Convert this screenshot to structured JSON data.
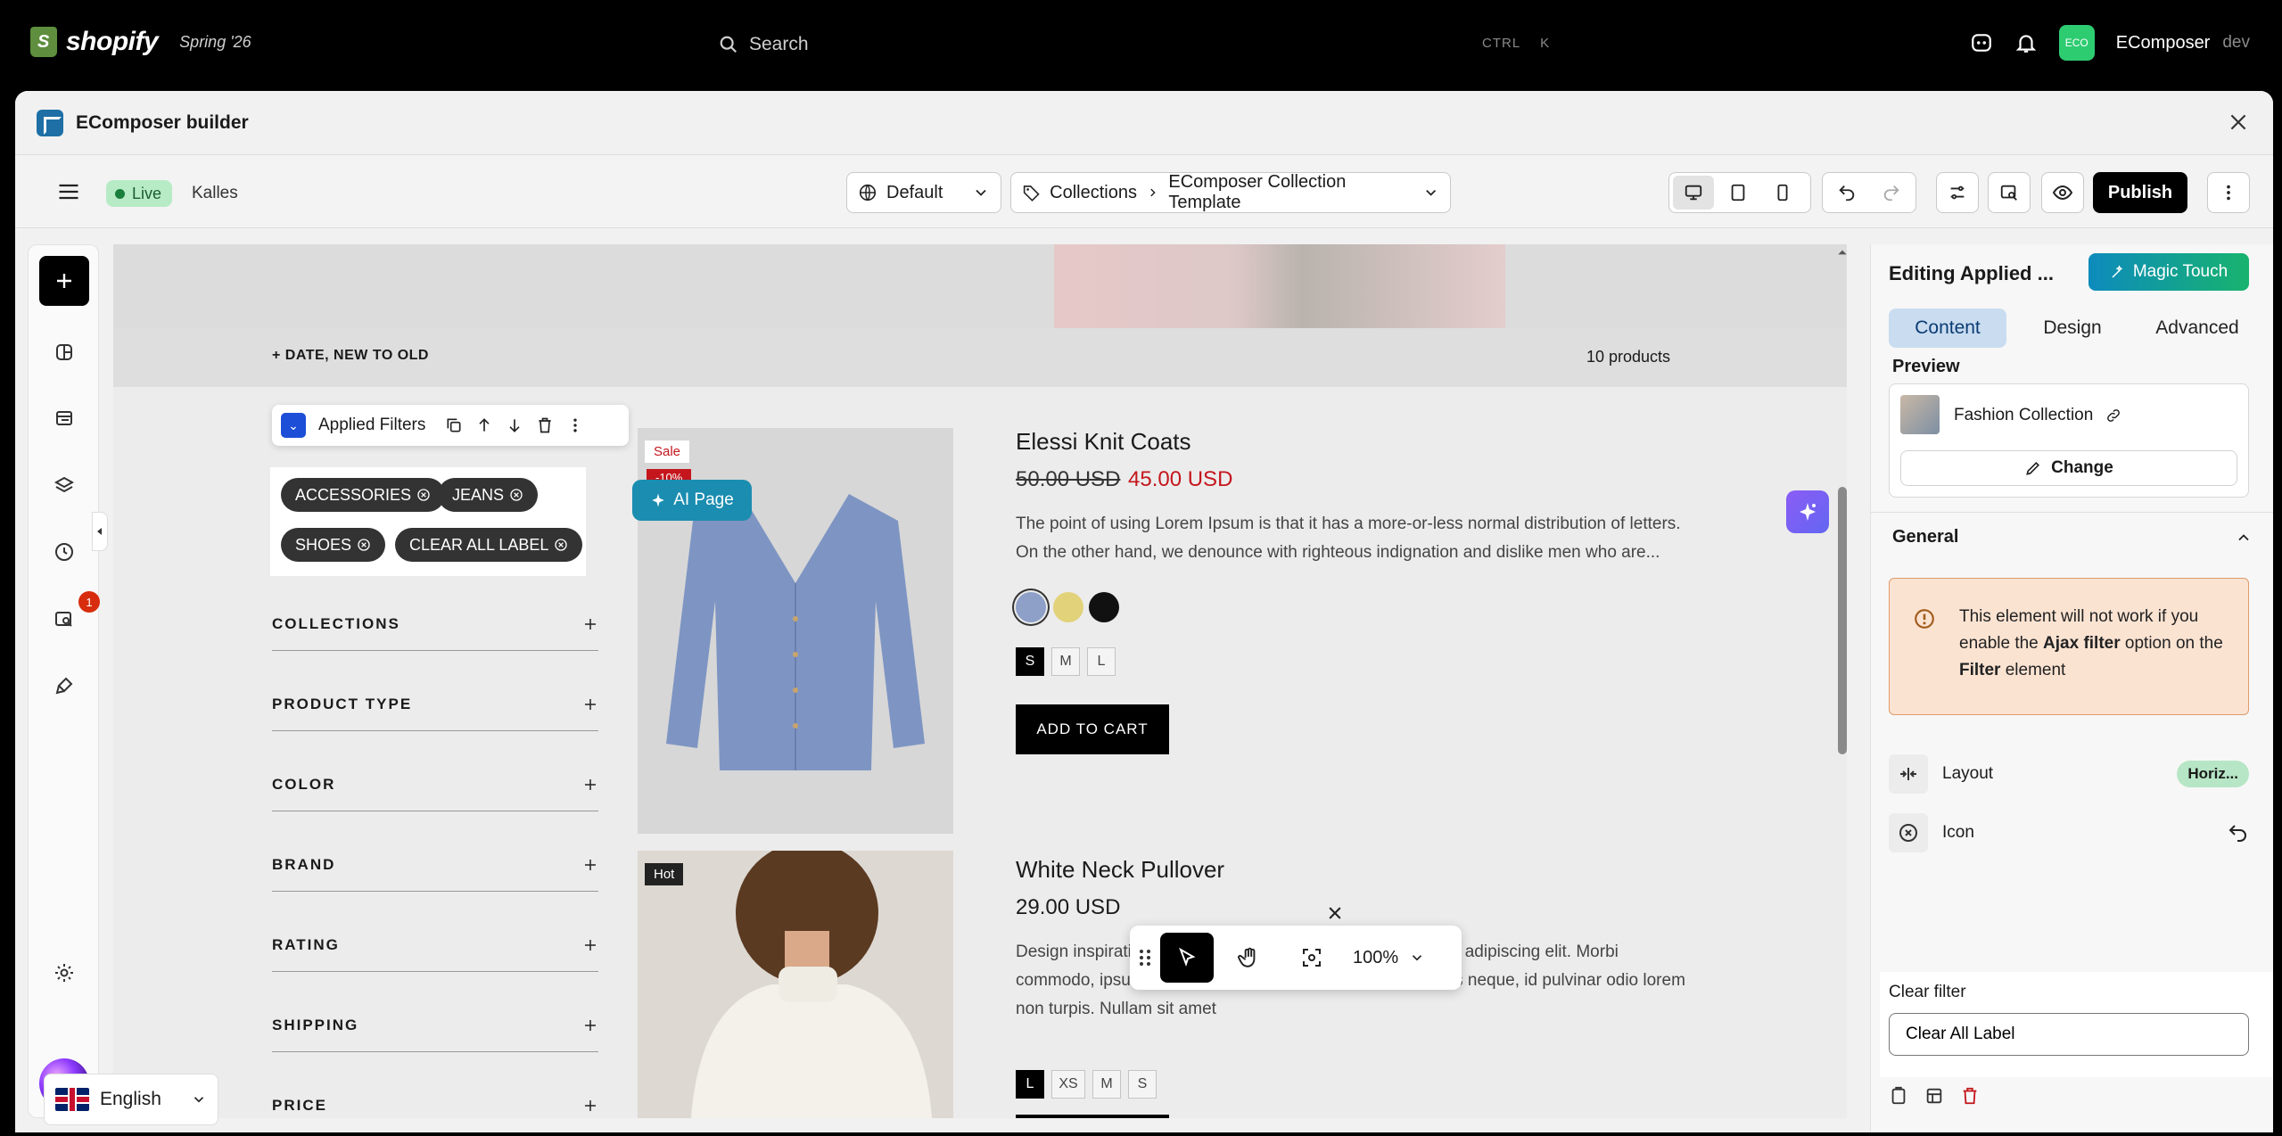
{
  "shopify": {
    "brand": "shopify",
    "season": "Spring '26",
    "search_label": "Search",
    "kbd_ctrl": "CTRL",
    "kbd_key": "K",
    "store_initials": "ECO",
    "store_name": "EComposer",
    "store_sub": "dev"
  },
  "window": {
    "title": "EComposer builder"
  },
  "toolbar": {
    "live_label": "Live",
    "theme_name": "Kalles",
    "language_select": "Default",
    "breadcrumb_root": "Collections",
    "breadcrumb_page": "EComposer Collection Template",
    "publish_label": "Publish"
  },
  "rail": {
    "notification_count": "1"
  },
  "canvas": {
    "sort_label": "DATE, NEW TO OLD",
    "product_count": "10 products",
    "selection_name": "Applied Filters",
    "chips": [
      "ACCESSORIES",
      "JEANS",
      "SHOES",
      "CLEAR ALL LABEL"
    ],
    "filters": [
      "COLLECTIONS",
      "PRODUCT TYPE",
      "COLOR",
      "BRAND",
      "RATING",
      "SHIPPING",
      "PRICE"
    ],
    "ai_page_label": "AI Page",
    "language": "English",
    "zoom": "100%",
    "products": [
      {
        "badge": "Sale",
        "discount": "-10%",
        "title": "Elessi Knit Coats",
        "old_price": "50.00 USD",
        "price": "45.00 USD",
        "description": "The point of using Lorem Ipsum is that it has a more-or-less normal distribution of letters. On the other hand, we denounce with righteous indignation and dislike men who are...",
        "sizes": [
          "S",
          "M",
          "L"
        ],
        "cart_label": "ADD TO CART"
      },
      {
        "badge": "Hot",
        "title": "White Neck Pullover",
        "price": "29.00 USD",
        "description": "Design inspiration lorem ipsum dolor sit amet, consectetuer adipiscing elit. Morbi commodo, ipsum sed pharetra gravida, orci magna rhoncus neque, id pulvinar odio lorem non turpis. Nullam sit amet",
        "sizes": [
          "L",
          "XS",
          "M",
          "S"
        ]
      }
    ]
  },
  "panel": {
    "title": "Editing Applied ...",
    "magic_touch": "Magic Touch",
    "tabs": [
      "Content",
      "Design",
      "Advanced"
    ],
    "preview_label": "Preview",
    "preview_name": "Fashion Collection",
    "change_label": "Change",
    "general_label": "General",
    "warning_pre": "This element will not work if you enable the ",
    "warning_b1": "Ajax filter",
    "warning_mid": " option on the ",
    "warning_b2": "Filter",
    "warning_post": " element",
    "layout_label": "Layout",
    "layout_value": "Horiz...",
    "icon_label": "Icon",
    "clear_filter_label": "Clear filter",
    "clear_filter_value": "Clear All Label"
  },
  "colors": {
    "accent_blue": "#c9dcf0",
    "publish": "#000000",
    "sale_red": "#c4161c",
    "warning_bg": "#fbe3d2"
  }
}
